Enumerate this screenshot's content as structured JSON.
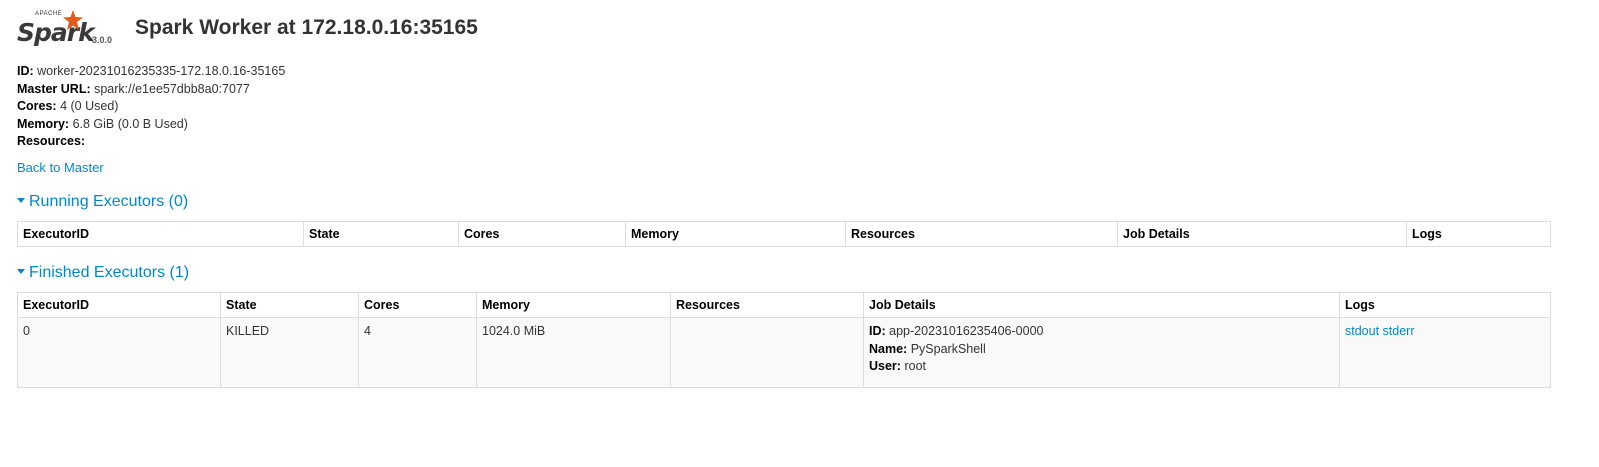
{
  "header": {
    "logo_apache": "APACHE",
    "logo_spark": "Spark",
    "version": "3.0.0",
    "title": "Spark Worker at 172.18.0.16:35165"
  },
  "info": {
    "id_label": "ID:",
    "id_value": "worker-20231016235335-172.18.0.16-35165",
    "master_label": "Master URL:",
    "master_value": "spark://e1ee57dbb8a0:7077",
    "cores_label": "Cores:",
    "cores_value": "4 (0 Used)",
    "memory_label": "Memory:",
    "memory_value": "6.8 GiB (0.0 B Used)",
    "resources_label": "Resources:"
  },
  "back_link": "Back to Master",
  "running": {
    "title": "Running Executors (0)",
    "columns": [
      "ExecutorID",
      "State",
      "Cores",
      "Memory",
      "Resources",
      "Job Details",
      "Logs"
    ]
  },
  "finished": {
    "title": "Finished Executors (1)",
    "columns": [
      "ExecutorID",
      "State",
      "Cores",
      "Memory",
      "Resources",
      "Job Details",
      "Logs"
    ],
    "rows": [
      {
        "executor_id": "0",
        "state": "KILLED",
        "cores": "4",
        "memory": "1024.0 MiB",
        "resources": "",
        "job_id_label": "ID:",
        "job_id": "app-20231016235406-0000",
        "job_name_label": "Name:",
        "job_name": "PySparkShell",
        "job_user_label": "User:",
        "job_user": "root",
        "log_stdout": "stdout",
        "log_stderr": "stderr"
      }
    ]
  },
  "colors": {
    "link": "#0088cc",
    "logo_star": "#e25a1c"
  }
}
